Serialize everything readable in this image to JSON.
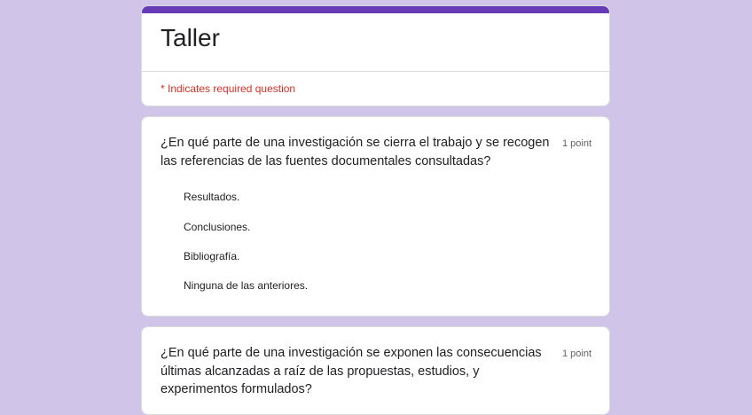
{
  "form": {
    "title": "Taller",
    "required_note": "* Indicates required question",
    "accent_color": "#673ab7",
    "background_color": "#d1c4e9"
  },
  "questions": [
    {
      "title": "¿En qué parte de una investigación se cierra el trabajo y se recogen las referencias de las fuentes documentales consultadas?",
      "points": "1 point",
      "options": [
        "Resultados.",
        "Conclusiones.",
        "Bibliografía.",
        "Ninguna de las anteriores."
      ]
    },
    {
      "title": "¿En qué parte de una investigación se exponen las consecuencias últimas alcanzadas a raíz de las propuestas, estudios, y experimentos formulados?",
      "points": "1 point"
    }
  ]
}
